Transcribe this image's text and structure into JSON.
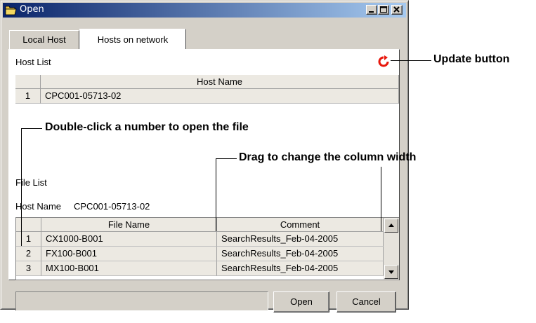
{
  "window": {
    "title": "Open"
  },
  "tabs": [
    {
      "label": "Local Host",
      "active": false
    },
    {
      "label": "Hosts on network",
      "active": true
    }
  ],
  "host_list": {
    "label": "Host List",
    "column_header": "Host Name",
    "rows": [
      {
        "num": "1",
        "name": "CPC001-05713-02"
      }
    ]
  },
  "file_list": {
    "label": "File List",
    "host_name_label": "Host Name",
    "host_name_value": "CPC001-05713-02",
    "columns": [
      "File Name",
      "Comment"
    ],
    "rows": [
      {
        "num": "1",
        "file": "CX1000-B001",
        "comment": "SearchResults_Feb-04-2005"
      },
      {
        "num": "2",
        "file": "FX100-B001",
        "comment": "SearchResults_Feb-04-2005"
      },
      {
        "num": "3",
        "file": "MX100-B001",
        "comment": "SearchResults_Feb-04-2005"
      }
    ]
  },
  "buttons": {
    "open": "Open",
    "cancel": "Cancel"
  },
  "callouts": {
    "update": "Update button",
    "double_click": "Double-click a number to open the file",
    "drag": "Drag to change the column width"
  },
  "colors": {
    "title_start": "#0a246a",
    "title_end": "#a6caf0",
    "update_icon": "#e8170c",
    "grid_bg": "#ece9e2"
  }
}
